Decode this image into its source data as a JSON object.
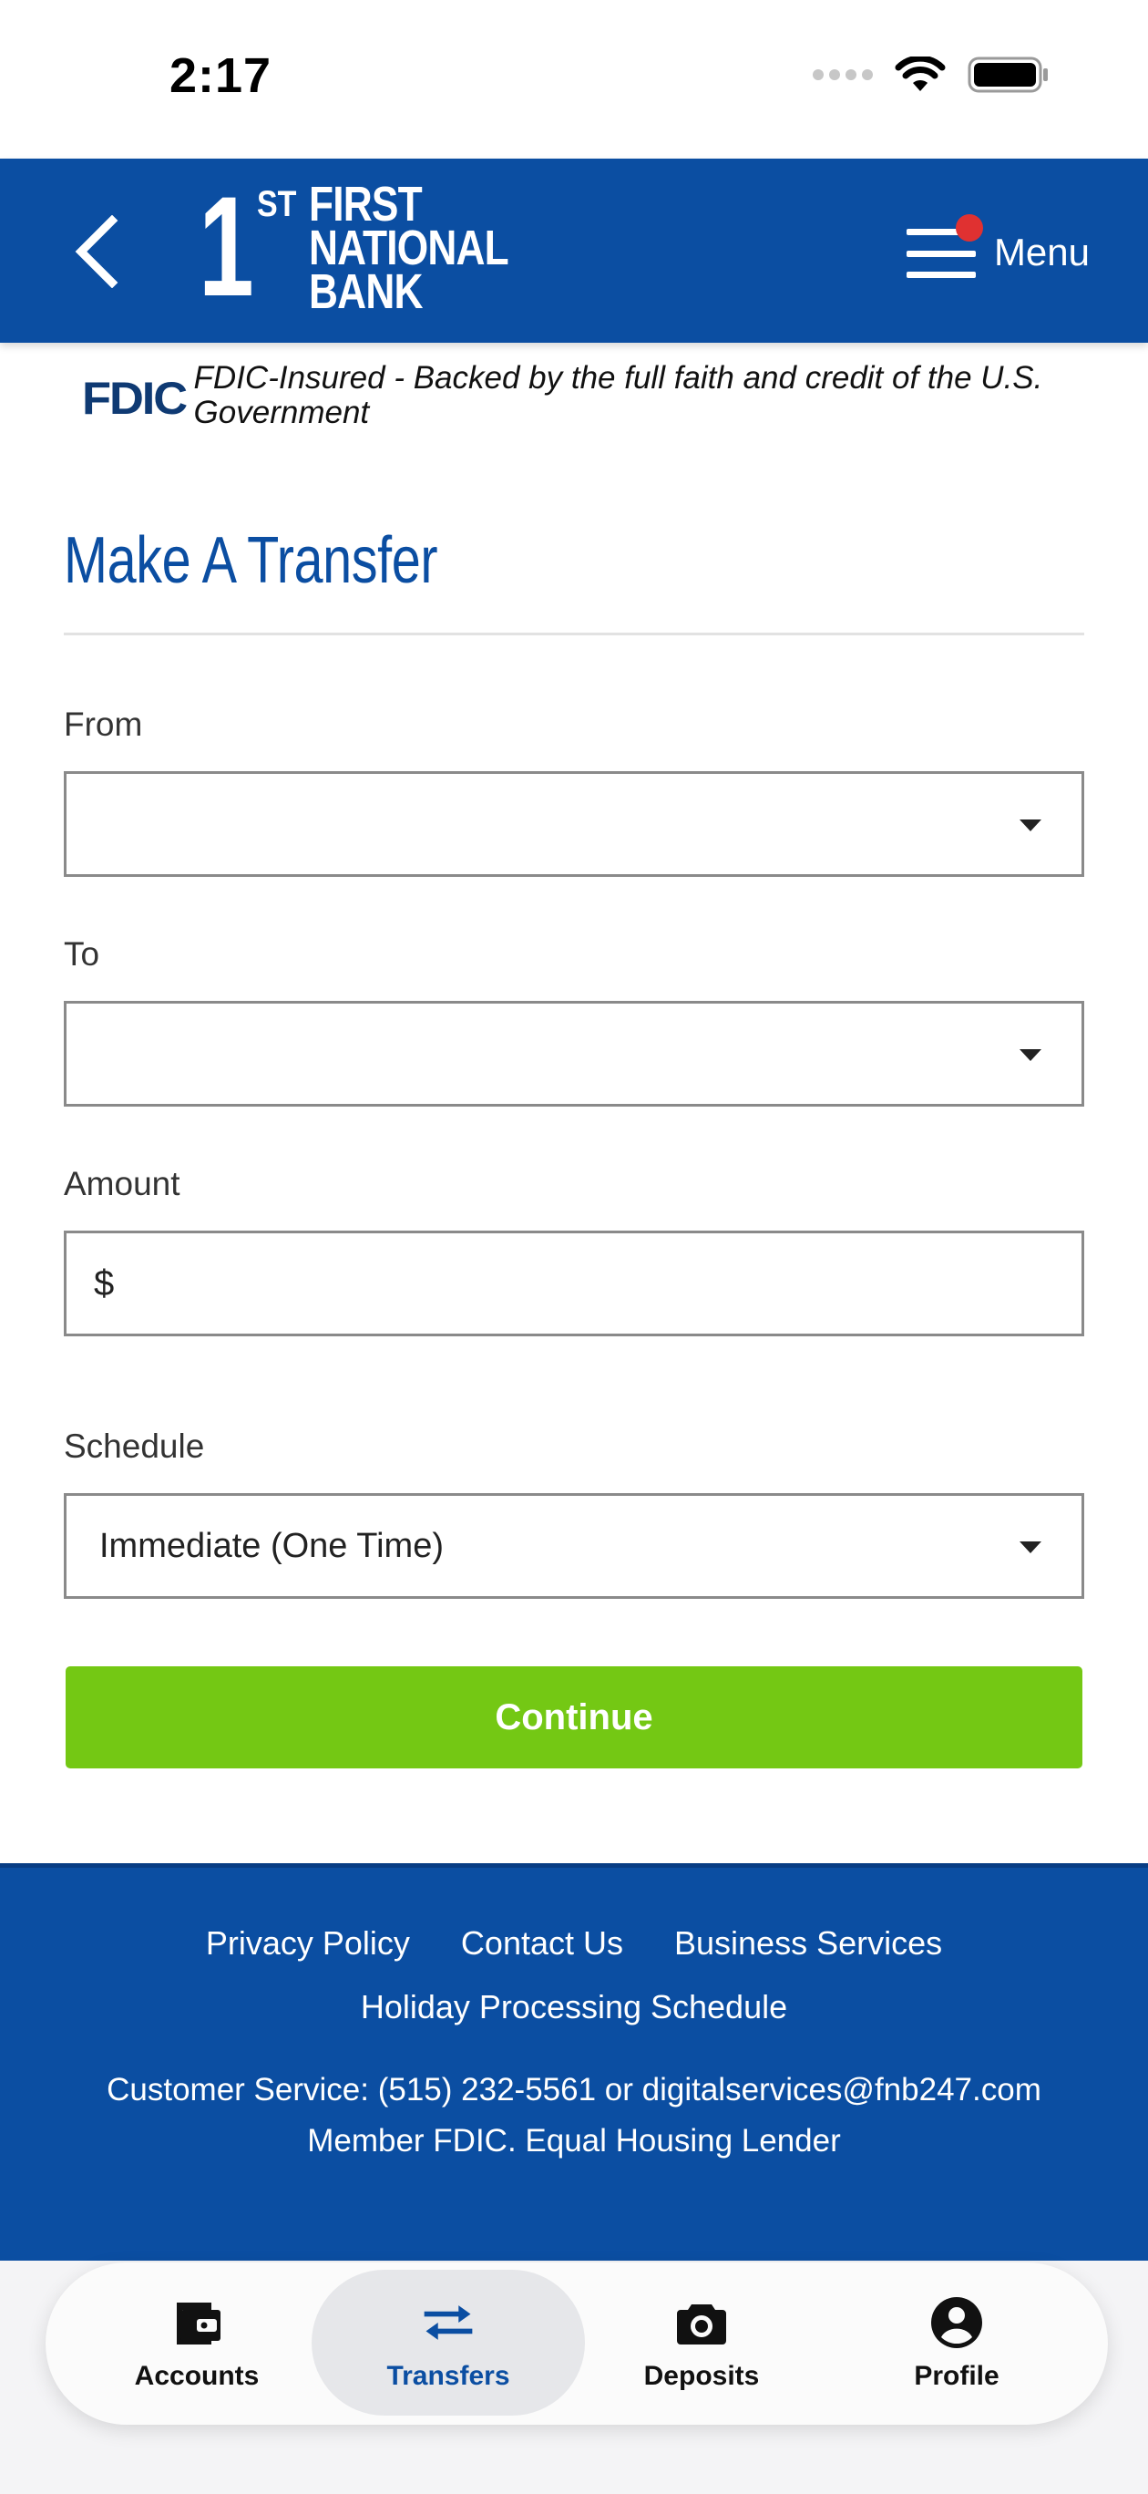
{
  "status_bar": {
    "time": "2:17"
  },
  "header": {
    "menu_label": "Menu"
  },
  "logo": {
    "one": "1",
    "st": "ST",
    "line1": "FIRST",
    "line2": "NATIONAL",
    "line3": "BANK"
  },
  "fdic": {
    "logo_text": "FDIC",
    "notice": "FDIC-Insured - Backed by the full faith and credit of the U.S. Government"
  },
  "form": {
    "title": "Make A Transfer",
    "from_label": "From",
    "from_value": "",
    "to_label": "To",
    "to_value": "",
    "amount_label": "Amount",
    "amount_currency": "$",
    "amount_value": "",
    "schedule_label": "Schedule",
    "schedule_value": "Immediate (One Time)",
    "continue_label": "Continue"
  },
  "footer": {
    "links": [
      "Privacy Policy",
      "Contact Us",
      "Business Services"
    ],
    "link_holiday": "Holiday Processing Schedule",
    "customer_service": "Customer Service: (515) 232-5561 or digitalservices@fnb247.com",
    "member": "Member FDIC. Equal Housing Lender"
  },
  "tabs": [
    {
      "label": "Accounts",
      "icon": "wallet-icon",
      "active": false
    },
    {
      "label": "Transfers",
      "icon": "transfer-arrows-icon",
      "active": true
    },
    {
      "label": "Deposits",
      "icon": "camera-icon",
      "active": false
    },
    {
      "label": "Profile",
      "icon": "profile-icon",
      "active": false
    }
  ],
  "colors": {
    "brand_blue": "#0b4ea2",
    "continue_green": "#74c814",
    "notification_red": "#e03131"
  }
}
